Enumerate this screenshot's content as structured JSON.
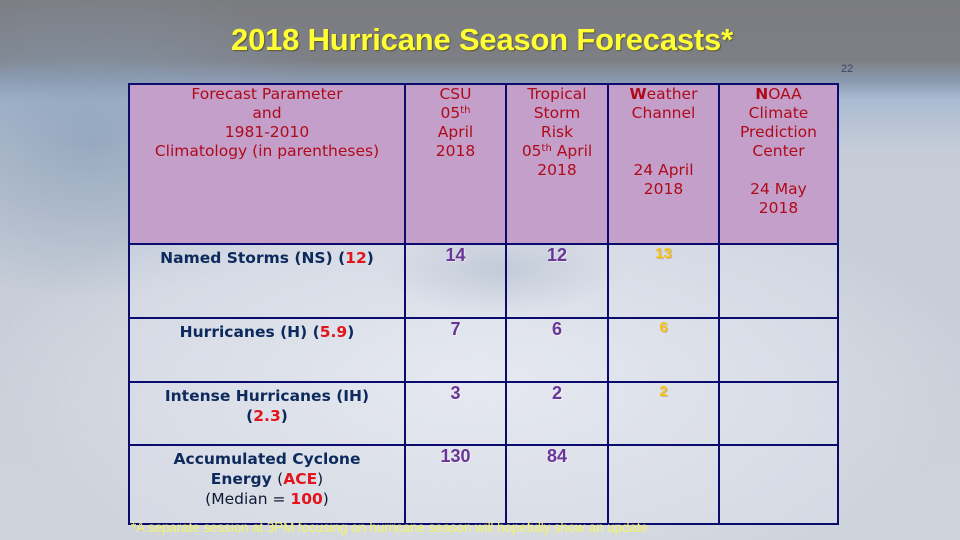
{
  "slide": {
    "title": "2018 Hurricane Season Forecasts*",
    "slide_number": "22",
    "footnote": "*A separate session at 3PM focusing on hurricane season will hopefully show an update"
  },
  "table": {
    "headers": {
      "parameter": [
        "Forecast Parameter",
        "and",
        "1981-2010",
        "Climatology (in parentheses)"
      ],
      "csu": {
        "lines": [
          "CSU"
        ],
        "day": "05",
        "day_sup": "th",
        "month": "April",
        "year": "2018"
      },
      "tsr": {
        "lines": [
          "Tropical",
          "Storm",
          "Risk"
        ],
        "day": "05",
        "day_sup": "th",
        "month": "April",
        "year": "2018"
      },
      "weather_channel": {
        "name_first_letter": "W",
        "name_rest": "eather",
        "line2": "Channel",
        "date": "24 April",
        "year": "2018"
      },
      "noaa": {
        "name_first_letter": "N",
        "name_rest": "OAA",
        "line2": "Climate",
        "line3": "Prediction",
        "line4": "Center",
        "date": "24 May",
        "year": "2018"
      }
    },
    "rows": [
      {
        "parameter": "Named Storms (NS)",
        "climatology": "12",
        "csu": "14",
        "tsr": "12",
        "weather_channel": "13",
        "noaa": ""
      },
      {
        "parameter": "Hurricanes (H)",
        "climatology": "5.9",
        "csu": "7",
        "tsr": "6",
        "weather_channel": "6",
        "noaa": ""
      },
      {
        "parameter": "Intense Hurricanes (IH)",
        "climatology": "2.3",
        "csu": "3",
        "tsr": "2",
        "weather_channel": "2",
        "noaa": ""
      },
      {
        "parameter_line1": "Accumulated Cyclone",
        "parameter_line2": "Energy",
        "abbr": "ACE",
        "median_label": "Median = ",
        "median_value": "100",
        "csu": "130",
        "tsr": "84",
        "weather_channel": "",
        "noaa": ""
      }
    ]
  },
  "colors": {
    "title": "#ffff33",
    "header_bg": "#c39fc9",
    "header_text": "#b00a1a",
    "border": "#0b0b6e",
    "parameter_text": "#0d2a5c",
    "climatology_text": "#e3141c",
    "value_purple": "#6b3597",
    "value_gold": "#f5c21a",
    "footnote": "#f3f36a"
  }
}
